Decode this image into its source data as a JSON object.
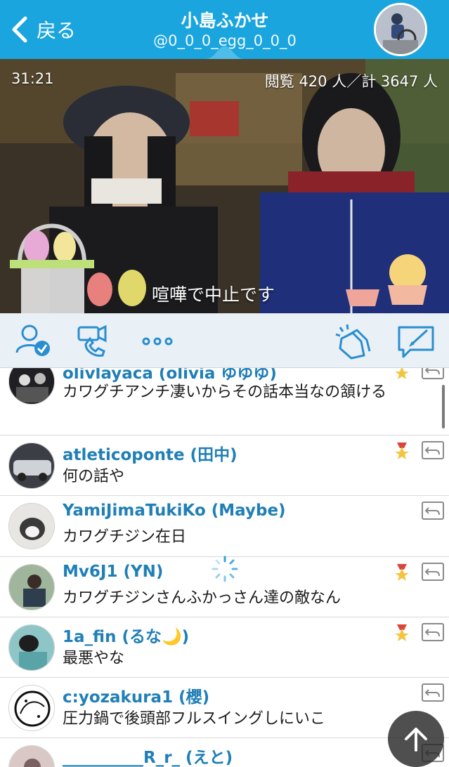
{
  "header": {
    "back_label": "戻る",
    "title": "小島ふかせ",
    "handle": "@0_0_0_egg_0_0_0"
  },
  "video": {
    "elapsed": "31:21",
    "viewers": "閲覧 420 人／計 3647 人",
    "caption": "喧嘩で中止です"
  },
  "toolbar": {
    "icons": [
      "follow-user-icon",
      "video-call-icon",
      "more-icon",
      "clap-icon",
      "compose-icon"
    ]
  },
  "comments": [
    {
      "user": "olivlayaca (olivia ゆゆゆ)",
      "text": "カワグチアンチ凄いからその話本当なの頷ける",
      "badge": true
    },
    {
      "user": "atleticoponte (田中)",
      "text": "何の話や",
      "badge": true
    },
    {
      "user": "YamiJimaTukiKo (Maybe)",
      "text": "カワグチジン在日",
      "badge": false
    },
    {
      "user": "Mv6J1 (YN)",
      "text": "カワグチジンさんふかっさん達の敵なん",
      "badge": true
    },
    {
      "user": "1a_fin (るな🌙)",
      "text": "最悪やな",
      "badge": true
    },
    {
      "user": "c:yozakura1 (櫻)",
      "text": "圧力鍋で後頭部フルスイングしにいこ",
      "badge": false
    },
    {
      "user": "__________R_r_ (えと)",
      "text": "",
      "badge": false
    }
  ],
  "colors": {
    "header_bg": "#1aa5df",
    "username": "#1f7fb6",
    "icon_blue": "#2a8ed0"
  }
}
